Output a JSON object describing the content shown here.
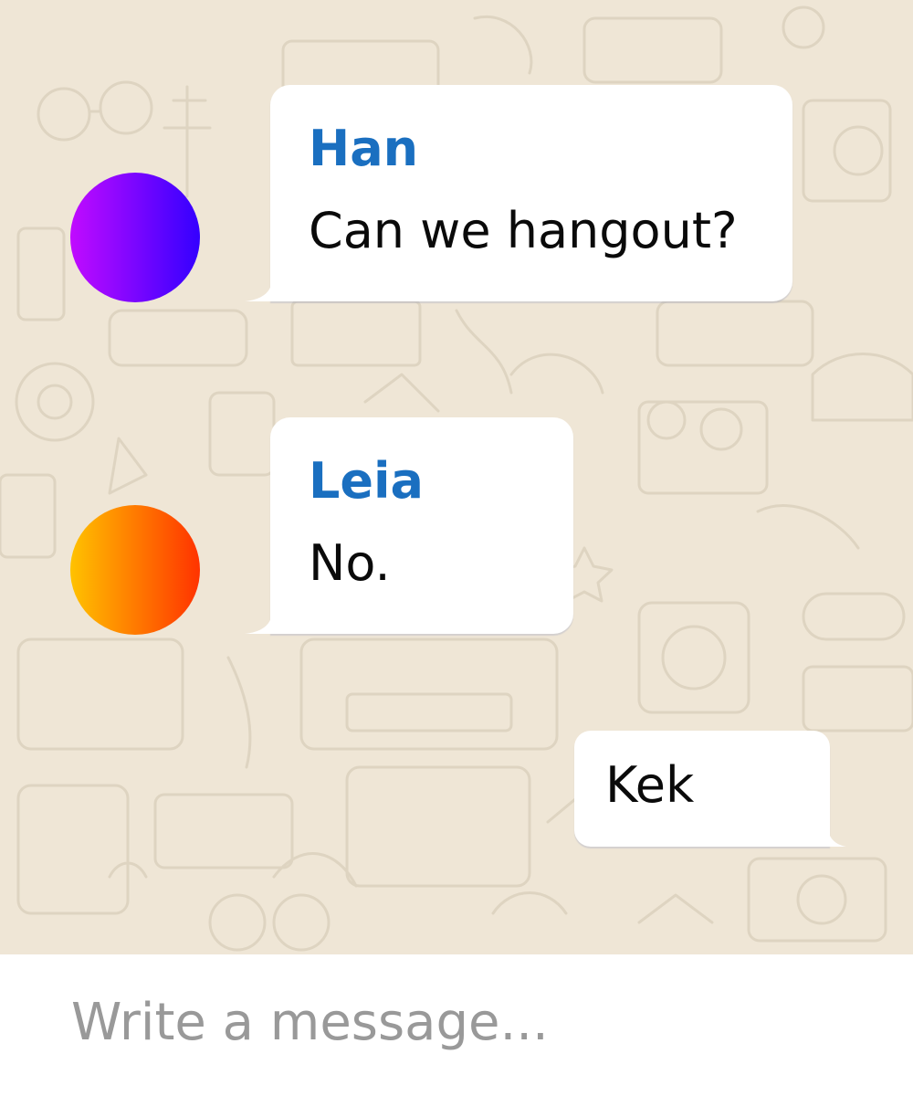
{
  "messages": [
    {
      "sender": "Han",
      "text": "Can we hangout?",
      "avatar_gradient": [
        "#c10bff",
        "#3400ff"
      ]
    },
    {
      "sender": "Leia",
      "text": "No.",
      "avatar_gradient": [
        "#ffc200",
        "#ff3300"
      ]
    }
  ],
  "outgoing": {
    "text": "Kek"
  },
  "composer": {
    "placeholder": "Write a message..."
  },
  "colors": {
    "wallpaper": "#efe6d6",
    "sender_name": "#1a6fc0",
    "bubble": "#ffffff",
    "placeholder": "#999999"
  }
}
